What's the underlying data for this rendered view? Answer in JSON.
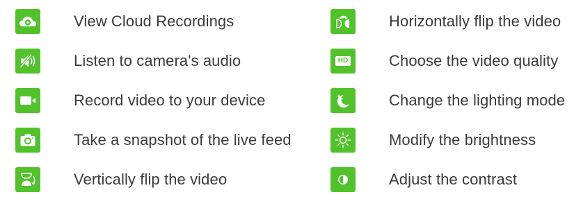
{
  "colors": {
    "icon_bg": "#52c22b",
    "text": "#3a3a3a",
    "background": "#ffffff"
  },
  "left_items": [
    {
      "icon": "cloud-play-icon",
      "label": "View Cloud Recordings"
    },
    {
      "icon": "muted-speaker-icon",
      "label": "Listen to camera's audio"
    },
    {
      "icon": "video-camera-icon",
      "label": "Record video to your device"
    },
    {
      "icon": "photo-camera-icon",
      "label": "Take a snapshot of the live feed"
    },
    {
      "icon": "vertical-flip-icon",
      "label": "Vertically flip the video"
    }
  ],
  "right_items": [
    {
      "icon": "horizontal-flip-icon",
      "label": "Horizontally flip the video"
    },
    {
      "icon": "hd-quality-icon",
      "label": "Choose the video quality",
      "badge": "HD"
    },
    {
      "icon": "night-mode-icon",
      "label": "Change the lighting mode"
    },
    {
      "icon": "sun-brightness-icon",
      "label": "Modify the brightness"
    },
    {
      "icon": "contrast-icon",
      "label": "Adjust the contrast"
    }
  ]
}
